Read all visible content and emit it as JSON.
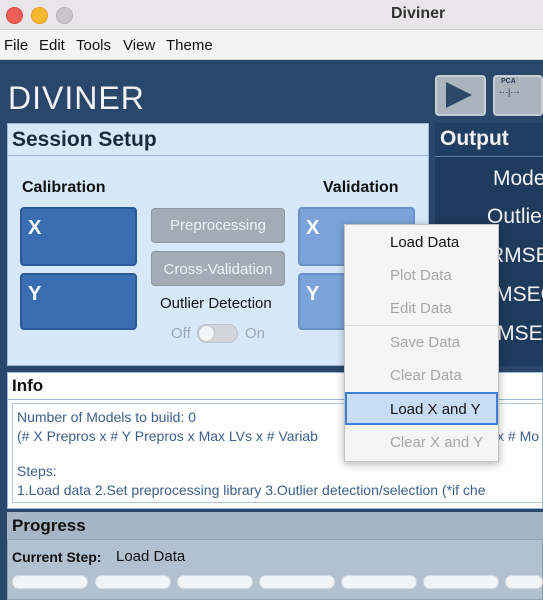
{
  "window": {
    "title": "Diviner"
  },
  "menubar": {
    "items": [
      "File",
      "Edit",
      "Tools",
      "View",
      "Theme"
    ]
  },
  "app": {
    "logo": "DIVINER"
  },
  "toolbar": {
    "pca_label": "PCA",
    "pca_graphic": "-··|··-"
  },
  "session": {
    "title": "Session Setup",
    "calibration": {
      "label": "Calibration",
      "x": "X",
      "y": "Y"
    },
    "validation": {
      "label": "Validation",
      "x": "X",
      "y": "Y"
    },
    "preprocessing": "Preprocessing",
    "cross_validation": "Cross-Validation",
    "outlier_label": "Outlier Detection",
    "toggle_off": "Off",
    "toggle_on": "On"
  },
  "output": {
    "title": "Output",
    "items": [
      "Mode",
      "Outlie",
      "RMSE",
      "RMSEC",
      "RMSE"
    ]
  },
  "info": {
    "title": "Info",
    "lines": [
      "Number of Models to build: 0",
      "(# X Prepros x # Y Prepros x Max LVs x # Variab",
      "x # Mo",
      "Steps:",
      "1.Load data  2.Set preprocessing library  3.Outlier detection/selection (*if che"
    ]
  },
  "context_menu": {
    "items": [
      {
        "label": "Load Data",
        "enabled": true
      },
      {
        "label": "Plot Data",
        "enabled": false
      },
      {
        "label": "Edit Data",
        "enabled": false
      },
      {
        "label": "Save Data",
        "enabled": false
      },
      {
        "label": "Clear Data",
        "enabled": false
      },
      {
        "label": "Load X and Y",
        "enabled": true,
        "highlighted": true
      },
      {
        "label": "Clear X and Y",
        "enabled": false
      }
    ]
  },
  "progress": {
    "title": "Progress",
    "step_label": "Current Step:",
    "step_value": "Load Data"
  },
  "colors": {
    "background": "#29476a",
    "calibration_button": "#3a6eb3",
    "validation_button": "#7ba3da",
    "panel": "#d6e8fa",
    "highlight": "#3d7fd6"
  }
}
